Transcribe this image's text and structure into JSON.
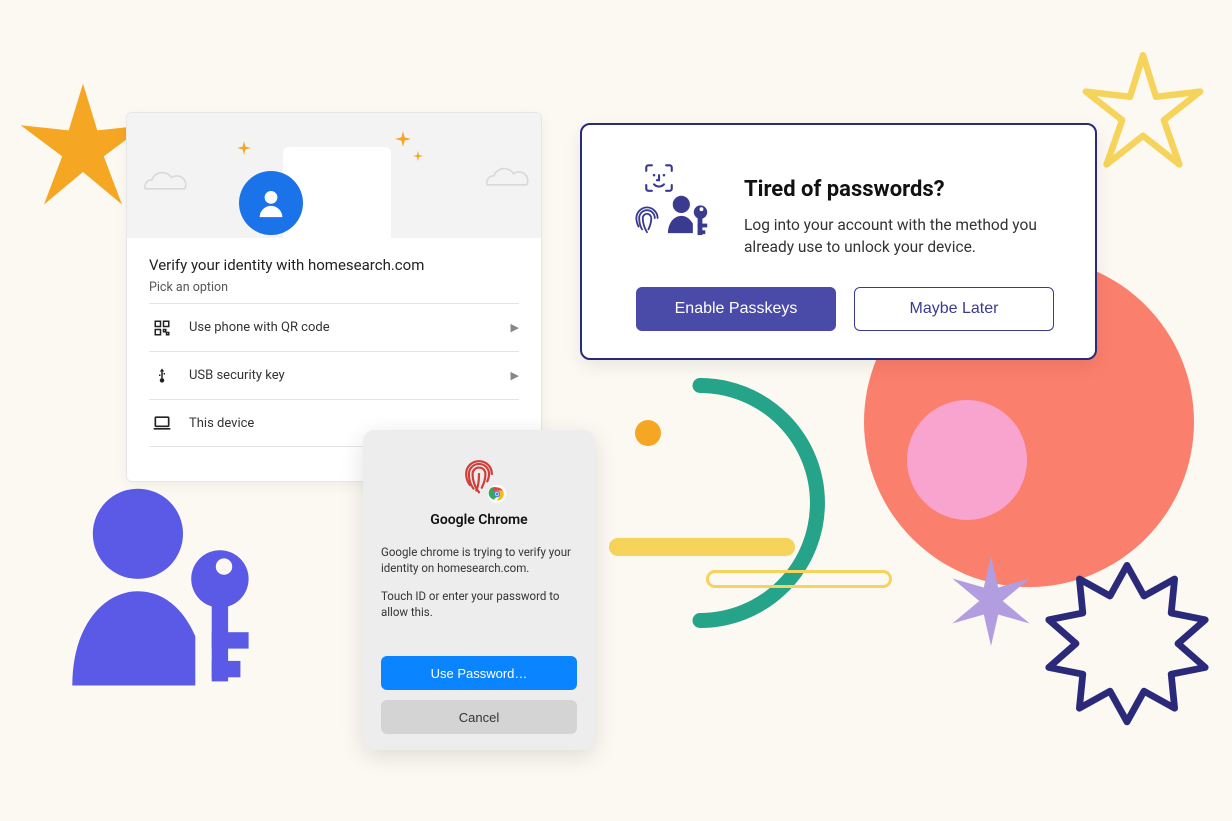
{
  "colors": {
    "bg": "#fcf9f2",
    "indigo": "#3b3a91",
    "primary_btn": "#4a4aa8",
    "coral": "#fb7f6d",
    "pink": "#f7a8d8",
    "teal": "#26a48a",
    "orange": "#f5a623",
    "yellow": "#f6d35b",
    "lavender": "#b29de0",
    "google_blue": "#1a73e8",
    "mac_blue": "#0a84ff"
  },
  "identity": {
    "title": "Verify your identity with homesearch.com",
    "subtitle": "Pick an option",
    "options": [
      {
        "icon": "qr-icon",
        "label": "Use phone with QR code",
        "has_arrow": true
      },
      {
        "icon": "usb-icon",
        "label": "USB security key",
        "has_arrow": true
      },
      {
        "icon": "laptop-icon",
        "label": "This device",
        "has_arrow": false
      }
    ]
  },
  "chrome_prompt": {
    "title": "Google Chrome",
    "body1": "Google chrome is trying to verify your identity on homesearch.com.",
    "body2": "Touch ID or enter your password to allow this.",
    "primary": "Use Password…",
    "secondary": "Cancel"
  },
  "passkey": {
    "heading": "Tired of passwords?",
    "body": "Log into your account with the method you already use to unlock your device.",
    "enable": "Enable Passkeys",
    "later": "Maybe Later"
  }
}
